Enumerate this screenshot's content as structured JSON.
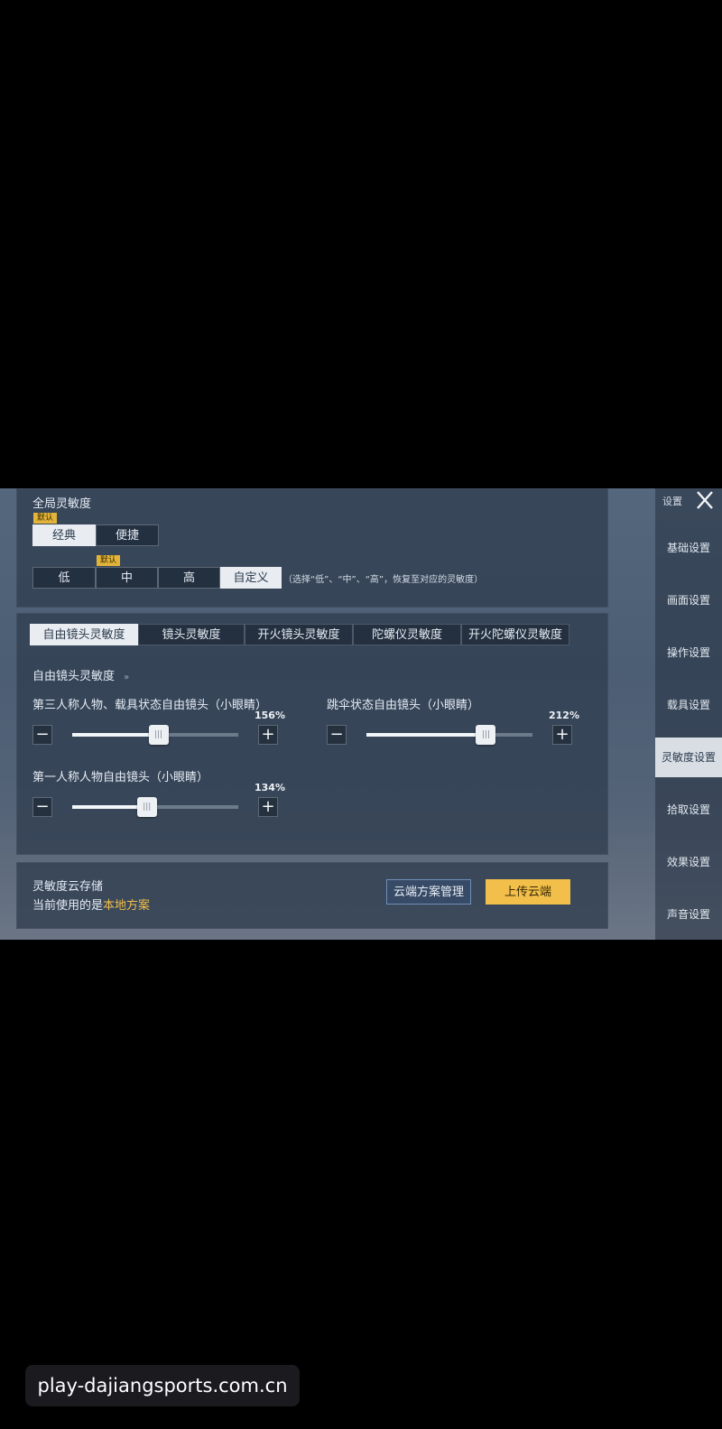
{
  "header": {
    "settings_label": "设置"
  },
  "global": {
    "title": "全局灵敏度",
    "default_badge": "默认",
    "modes": [
      "经典",
      "便捷"
    ],
    "presets": [
      "低",
      "中",
      "高",
      "自定义"
    ],
    "preset_hint": "（选择“低”、“中”、“高”，恢复至对应的灵敏度）"
  },
  "tabs": [
    "自由镜头灵敏度",
    "镜头灵敏度",
    "开火镜头灵敏度",
    "陀螺仪灵敏度",
    "开火陀螺仪灵敏度"
  ],
  "section": {
    "title": "自由镜头灵敏度",
    "arrow": "»",
    "sliders": [
      {
        "label": "第三人称人物、载具状态自由镜头（小眼睛）",
        "value": "156%",
        "fraction": 0.52
      },
      {
        "label": "跳伞状态自由镜头（小眼睛）",
        "value": "212%",
        "fraction": 0.72
      },
      {
        "label": "第一人称人物自由镜头（小眼睛）",
        "value": "134%",
        "fraction": 0.45
      }
    ]
  },
  "cloud": {
    "title": "灵敏度云存储",
    "current_prefix": "当前使用的是",
    "current_value": "本地方案",
    "manage_label": "云端方案管理",
    "upload_label": "上传云端"
  },
  "sidebar": [
    "基础设置",
    "画面设置",
    "操作设置",
    "载具设置",
    "灵敏度设置",
    "拾取设置",
    "效果设置",
    "声音设置"
  ],
  "sidebar_active": 4,
  "watermark": "play-dajiangsports.com.cn",
  "colors": {
    "accent": "#f1bf4a",
    "badge": "#e2b43a",
    "active_tab": "#e9edf2"
  }
}
